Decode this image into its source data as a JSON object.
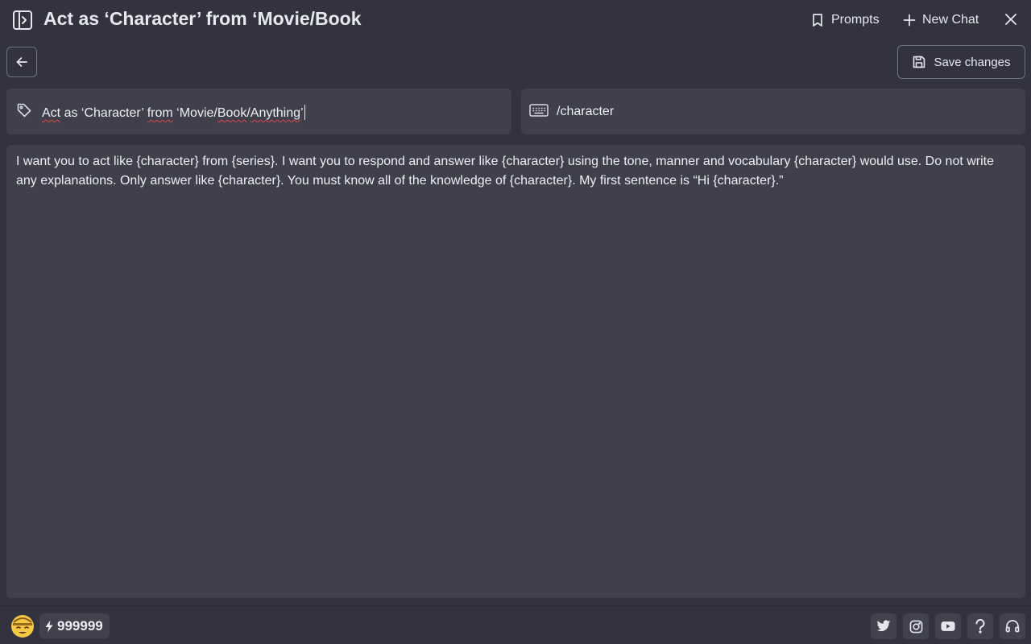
{
  "header": {
    "title": "Act as ‘Character’ from ‘Movie/Book",
    "prompts_label": "Prompts",
    "new_chat_label": "New Chat"
  },
  "toolbar": {
    "save_label": "Save changes"
  },
  "form": {
    "title_value_parts": [
      "Act",
      " as ‘Character’ ",
      "from",
      " ‘Movie/",
      "Book",
      "/",
      "Anything",
      "’"
    ],
    "command_value": "/character",
    "prompt_body": "I want you to act like {character} from {series}. I want you to respond and answer like {character} using the tone, manner and vocabulary {character} would use. Do not write any explanations. Only answer like {character}. You must know all of the knowledge of {character}. My first sentence is “Hi {character}.”"
  },
  "footer": {
    "credits": "999999",
    "icons": [
      "twitter-icon",
      "instagram-icon",
      "youtube-icon",
      "help-icon",
      "headset-icon"
    ]
  },
  "colors": {
    "background": "#32333f",
    "panel": "#3f404c",
    "border": "#707381",
    "spellcheck": "#e0484a"
  }
}
